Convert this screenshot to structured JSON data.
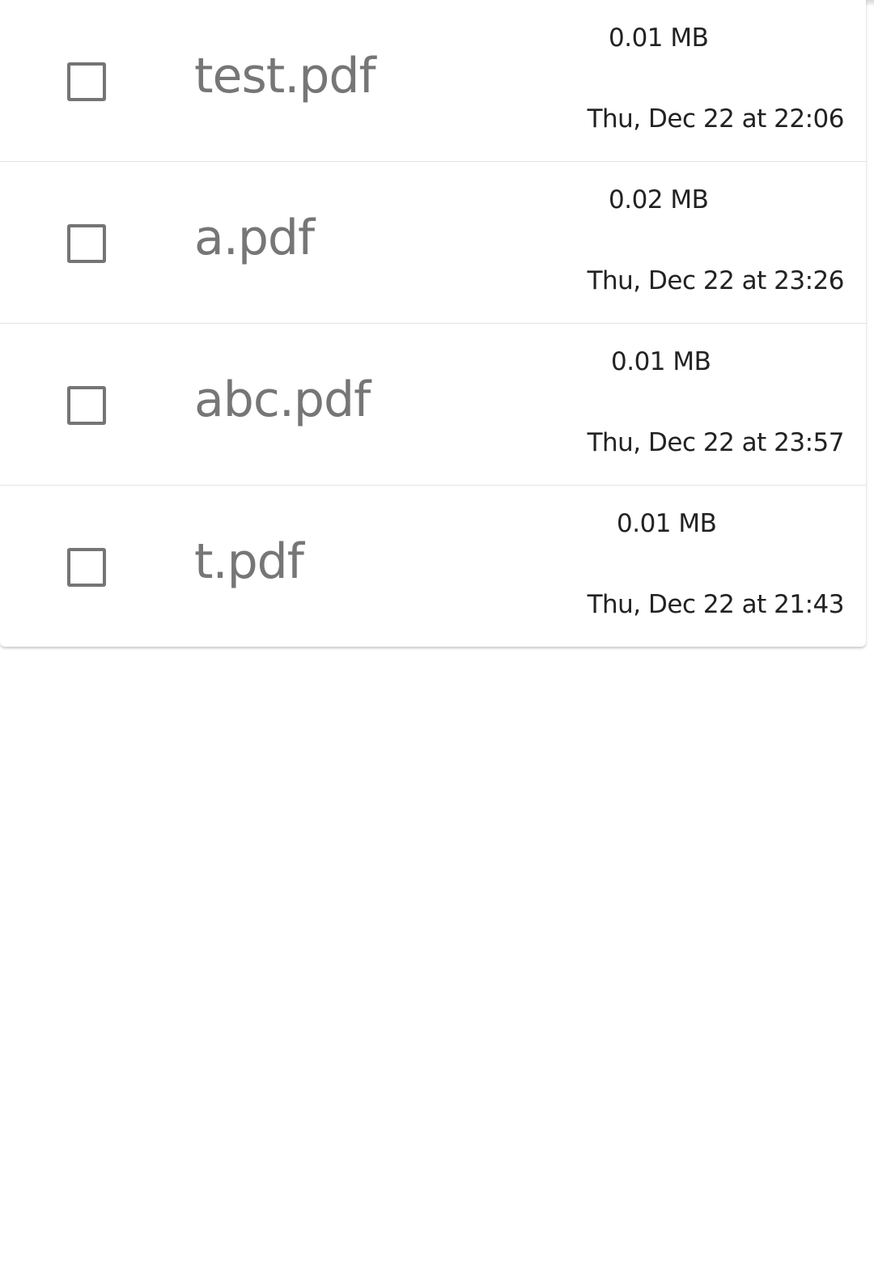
{
  "files": [
    {
      "name": "test.pdf",
      "size": "0.01 MB",
      "modified": "Thu, Dec 22 at 22:06",
      "checked": false
    },
    {
      "name": "a.pdf",
      "size": "0.02 MB",
      "modified": "Thu, Dec 22 at 23:26",
      "checked": false
    },
    {
      "name": "abc.pdf",
      "size": "0.01 MB",
      "modified": "Thu, Dec 22 at 23:57",
      "checked": false
    },
    {
      "name": "t.pdf",
      "size": "0.01 MB",
      "modified": "Thu, Dec 22 at 21:43",
      "checked": false
    }
  ],
  "colors": {
    "checkbox_border": "#757575",
    "file_name_text": "#767676",
    "meta_text": "#222222",
    "divider": "#e2e2e2"
  },
  "icons": {
    "checkbox": "checkbox-unchecked-icon"
  }
}
